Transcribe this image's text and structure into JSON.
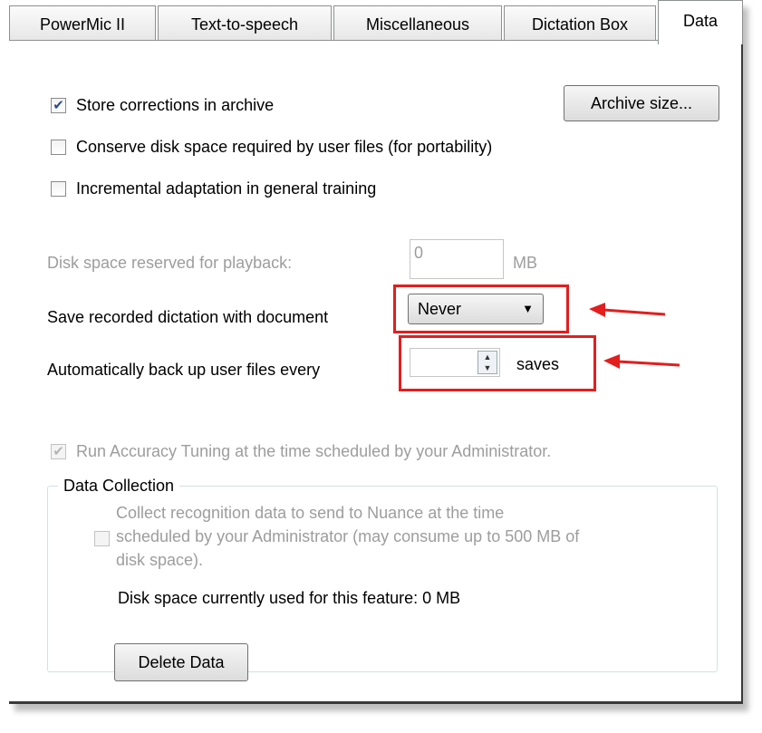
{
  "tabs": [
    {
      "label": "PowerMic II"
    },
    {
      "label": "Text-to-speech"
    },
    {
      "label": "Miscellaneous"
    },
    {
      "label": "Dictation Box"
    },
    {
      "label": "Data"
    }
  ],
  "options": {
    "store_corrections": {
      "label": "Store corrections in archive",
      "checked": true
    },
    "conserve_disk": {
      "label": "Conserve disk space required by user files (for portability)",
      "checked": false
    },
    "incremental": {
      "label": "Incremental adaptation in general training",
      "checked": false
    }
  },
  "archive_button": "Archive size...",
  "playback": {
    "label": "Disk space reserved for playback:",
    "value": "0",
    "unit": "MB"
  },
  "save_dictation": {
    "label": "Save recorded dictation with document",
    "selected": "Never"
  },
  "backup": {
    "label": "Automatically back up user files every",
    "value": "",
    "unit": "saves"
  },
  "accuracy_tuning": {
    "label": "Run Accuracy Tuning at the time scheduled by your Administrator.",
    "checked": true
  },
  "data_collection": {
    "title": "Data Collection",
    "collect_line1": "Collect recognition data to send to Nuance at the time",
    "collect_line2": "scheduled by your Administrator (may consume up to 500 MB of",
    "collect_line3": "disk space).",
    "disk_used": "Disk space currently used for this feature: 0 MB",
    "delete_button": "Delete Data"
  },
  "colors": {
    "highlight": "#e31e1e",
    "check": "#2a4d8f"
  }
}
